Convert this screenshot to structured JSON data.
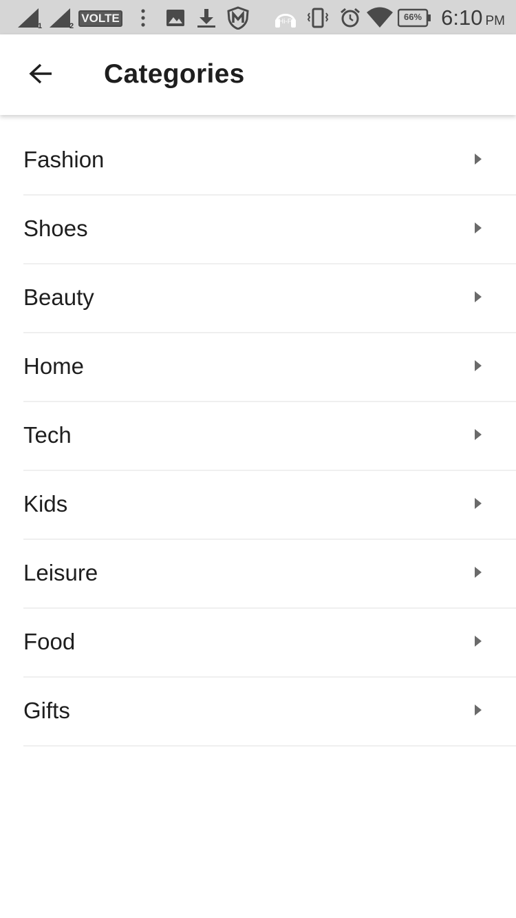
{
  "status_bar": {
    "sim1_label": "1",
    "sim2_label": "2",
    "volte": "VOLTE",
    "battery": "66%",
    "hifi": "Hi-Fi",
    "time": "6:10",
    "ampm": "PM"
  },
  "app_bar": {
    "title": "Categories",
    "back_icon": "arrow-left-icon"
  },
  "categories": [
    {
      "label": "Fashion"
    },
    {
      "label": "Shoes"
    },
    {
      "label": "Beauty"
    },
    {
      "label": "Home"
    },
    {
      "label": "Tech"
    },
    {
      "label": "Kids"
    },
    {
      "label": "Leisure"
    },
    {
      "label": "Food"
    },
    {
      "label": "Gifts"
    }
  ],
  "colors": {
    "status_bar_bg": "#d6d6d6",
    "text": "#1e1e1e",
    "divider": "#efefef",
    "chevron": "#6a6a6a"
  }
}
